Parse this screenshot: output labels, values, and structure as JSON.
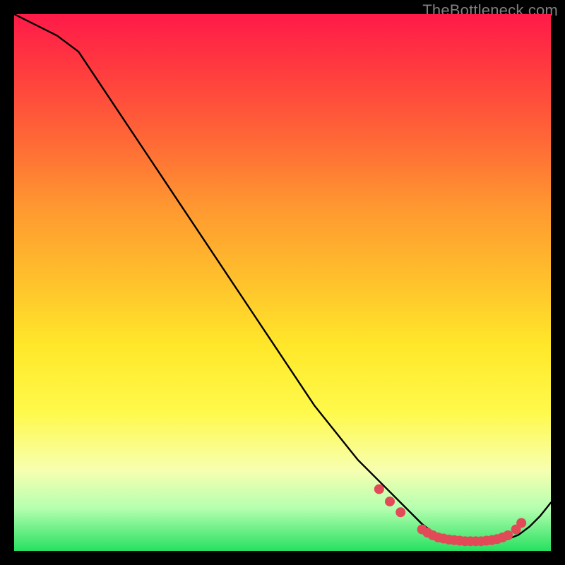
{
  "watermark": "TheBottleneck.com",
  "chart_data": {
    "type": "line",
    "title": "",
    "xlabel": "",
    "ylabel": "",
    "xlim": [
      0,
      100
    ],
    "ylim": [
      0,
      100
    ],
    "series": [
      {
        "name": "curve",
        "x": [
          0,
          4,
          8,
          12,
          16,
          20,
          24,
          28,
          32,
          36,
          40,
          44,
          48,
          52,
          56,
          60,
          64,
          68,
          72,
          76,
          78,
          80,
          82,
          84,
          86,
          88,
          90,
          92,
          94,
          96,
          98,
          100
        ],
        "y": [
          100,
          98,
          96,
          93,
          87,
          81,
          75,
          69,
          63,
          57,
          51,
          45,
          39,
          33,
          27,
          22,
          17,
          13,
          9,
          5,
          3.5,
          2.5,
          2,
          1.8,
          1.7,
          1.7,
          1.8,
          2.2,
          3,
          4.5,
          6.5,
          9
        ]
      }
    ],
    "markers": {
      "name": "points",
      "color": "#e24a58",
      "radius": 7,
      "x": [
        68,
        70,
        72,
        76,
        77,
        78,
        79,
        80,
        81,
        82,
        83,
        84,
        85,
        86,
        87,
        88,
        89,
        90,
        91,
        92,
        93.5,
        94.5
      ],
      "y": [
        11.5,
        9.2,
        7.2,
        4.0,
        3.4,
        2.9,
        2.5,
        2.3,
        2.1,
        2.0,
        1.9,
        1.8,
        1.8,
        1.8,
        1.8,
        1.9,
        2.0,
        2.2,
        2.5,
        2.9,
        4.0,
        5.2
      ]
    }
  }
}
